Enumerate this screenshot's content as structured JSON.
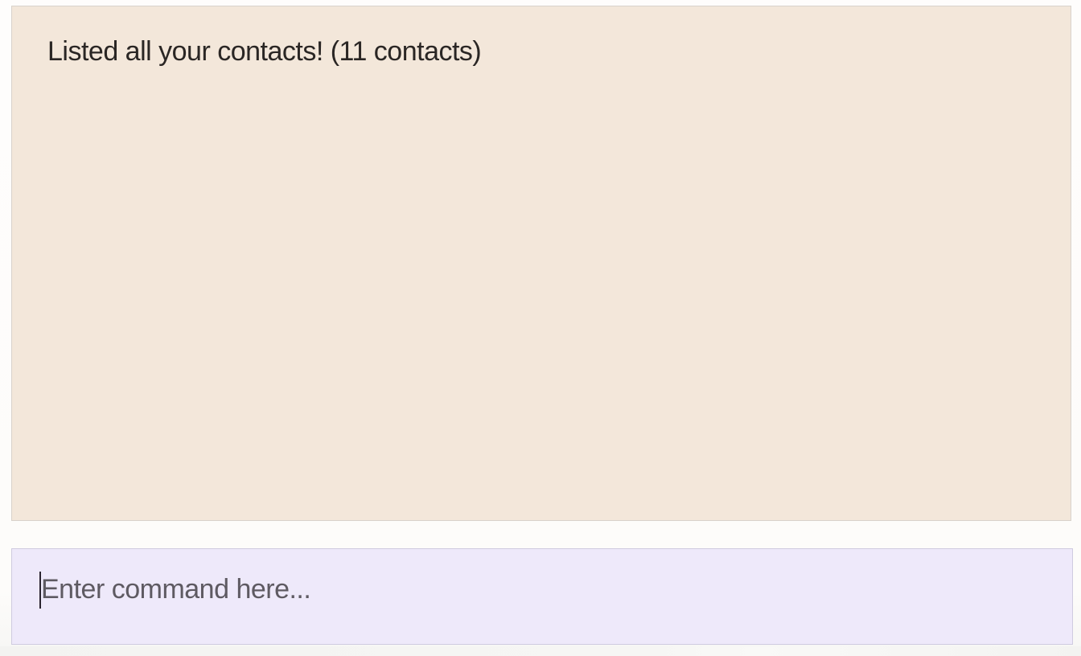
{
  "result_display": {
    "message": "Listed all your contacts! (11 contacts)"
  },
  "command_box": {
    "value": "",
    "placeholder": "Enter command here..."
  },
  "colors": {
    "result_background": "#f3e7da",
    "command_background": "#eee9fa",
    "text": "#2a2624",
    "placeholder": "#5e5a62"
  }
}
